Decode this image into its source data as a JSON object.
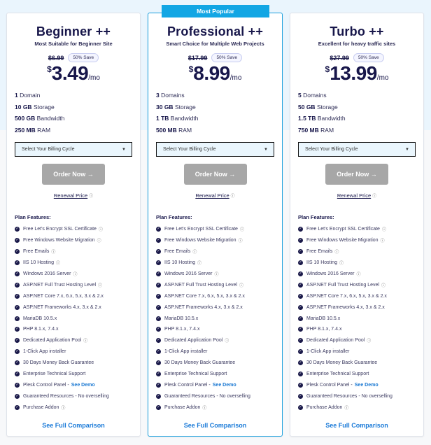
{
  "colors": {
    "accent": "#12a6e4",
    "navy": "#17164a",
    "link": "#1a7ad8",
    "disabled_button": "#a7a7a7",
    "top_background": "#eaf5fd"
  },
  "common": {
    "billing_select_placeholder": "Select Your Billing Cycle",
    "order_button": "Order Now →",
    "renewal_price": "Renewal Price",
    "features_title": "Plan Features:",
    "see_demo": "See Demo",
    "compare_link": "See Full Comparison",
    "info_icon": "ⓘ",
    "per_month": "/mo",
    "currency": "$"
  },
  "plans": [
    {
      "name": "Beginner ++",
      "tagline": "Most Suitable for Beginner Site",
      "old_price": "$6.99",
      "save_label": "50% Save",
      "price": "3.49",
      "specs": [
        {
          "value": "1",
          "label": "Domain"
        },
        {
          "value": "10 GB",
          "label": "Storage"
        },
        {
          "value": "500 GB",
          "label": "Bandwidth"
        },
        {
          "value": "250 MB",
          "label": "RAM"
        }
      ]
    },
    {
      "badge": "Most Popular",
      "name": "Professional ++",
      "tagline": "Smart Choice for Multiple Web Projects",
      "old_price": "$17.99",
      "save_label": "50% Save",
      "price": "8.99",
      "specs": [
        {
          "value": "3",
          "label": "Domains"
        },
        {
          "value": "30 GB",
          "label": "Storage"
        },
        {
          "value": "1 TB",
          "label": "Bandwidth"
        },
        {
          "value": "500 MB",
          "label": "RAM"
        }
      ]
    },
    {
      "name": "Turbo ++",
      "tagline": "Excellent for heavy traffic sites",
      "old_price": "$27.99",
      "save_label": "50% Save",
      "price": "13.99",
      "specs": [
        {
          "value": "5",
          "label": "Domains"
        },
        {
          "value": "50 GB",
          "label": "Storage"
        },
        {
          "value": "1.5 TB",
          "label": "Bandwidth"
        },
        {
          "value": "750 MB",
          "label": "RAM"
        }
      ]
    }
  ],
  "features": [
    {
      "text": "Free Let's Encrypt SSL Certificate",
      "info": true
    },
    {
      "text": "Free Windows Website Migration",
      "info": true
    },
    {
      "text": "Free Emails",
      "info": true
    },
    {
      "text": "IIS 10 Hosting",
      "info": true
    },
    {
      "text": "Windows 2016 Server",
      "info": true
    },
    {
      "text": "ASP.NET Full Trust Hosting Level",
      "info": true
    },
    {
      "text": "ASP.NET Core 7.x, 6.x, 5.x, 3.x & 2.x",
      "info": false
    },
    {
      "text": "ASP.NET Frameworks 4.x, 3.x & 2.x",
      "info": false
    },
    {
      "text": "MariaDB 10.5.x",
      "info": false
    },
    {
      "text": "PHP 8.1.x, 7.4.x",
      "info": false
    },
    {
      "text": "Dedicated Application Pool",
      "info": true
    },
    {
      "text": "1-Click App installer",
      "info": false
    },
    {
      "text": "30 Days Money Back Guarantee",
      "info": false
    },
    {
      "text": "Enterprise Technical Support",
      "info": false
    },
    {
      "text": "Plesk Control Panel -",
      "info": false,
      "demo": true
    },
    {
      "text": "Guaranteed Resources - No overselling",
      "info": false
    },
    {
      "text": "Purchase Addon",
      "info": true
    }
  ]
}
